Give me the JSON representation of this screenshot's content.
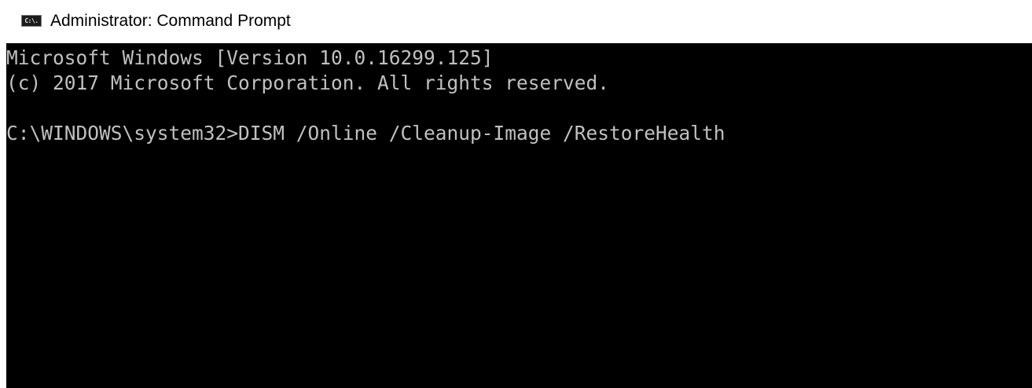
{
  "window": {
    "title": "Administrator: Command Prompt",
    "icon": "command-prompt-icon",
    "icon_text": "C:\\."
  },
  "console": {
    "background_color": "#000000",
    "text_color": "#c0c0c0",
    "lines": [
      "Microsoft Windows [Version 10.0.16299.125]",
      "(c) 2017 Microsoft Corporation. All rights reserved.",
      "",
      "C:\\WINDOWS\\system32>DISM /Online /Cleanup-Image /RestoreHealth"
    ]
  }
}
